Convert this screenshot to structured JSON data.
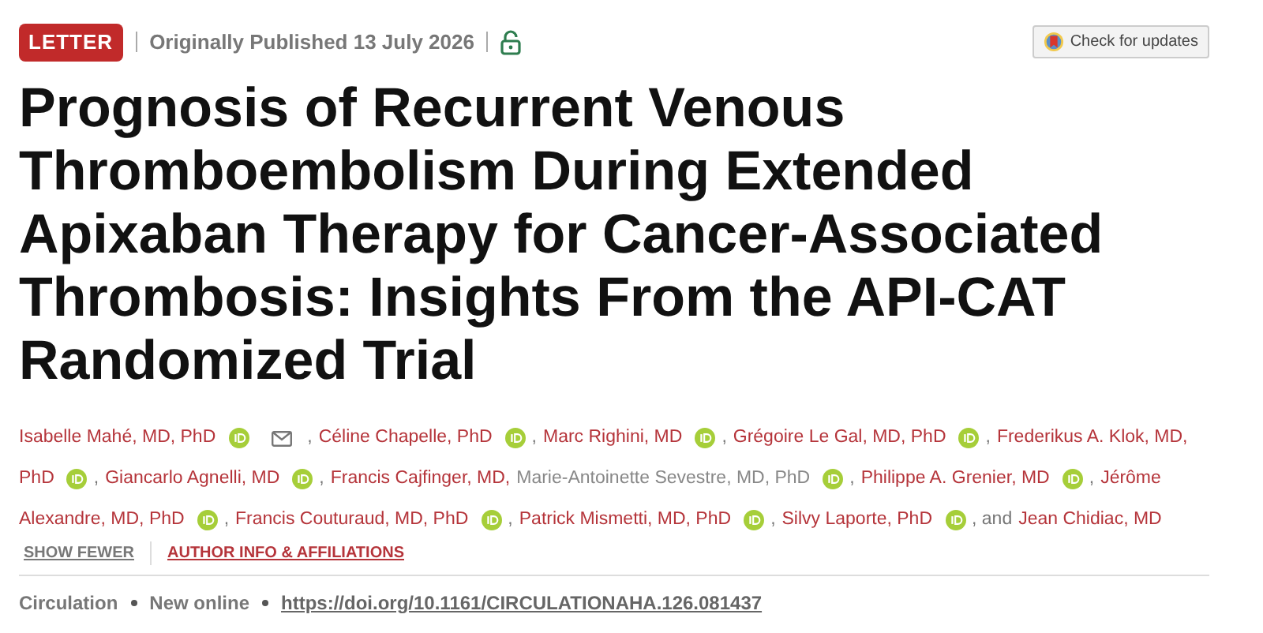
{
  "header": {
    "badge": "LETTER",
    "published": "Originally Published 13 July 2026",
    "open_access": true,
    "updates_button": "Check for updates"
  },
  "title": "Prognosis of Recurrent Venous Thromboembolism During Extended Apixaban Therapy for Cancer-Associated Thrombosis: Insights From the API-CAT Randomized Trial",
  "author_lines": [
    [
      {
        "name": "Isabelle Mahé, MD, PhD",
        "linked": true,
        "orcid": true,
        "email": true
      },
      {
        "prefix": ",",
        "name": "Céline Chapelle, PhD",
        "linked": true,
        "orcid": true
      },
      {
        "prefix": ",",
        "name": "Marc Righini, MD",
        "linked": true,
        "orcid": true
      },
      {
        "prefix": ",",
        "name": "Grégoire Le Gal, MD, PhD",
        "linked": true,
        "orcid": true
      },
      {
        "prefix": ",",
        "name": "Frederikus A. Klok, MD,",
        "linked": true
      }
    ],
    [
      {
        "name": "PhD",
        "linked": true,
        "orcid": true
      },
      {
        "prefix": ",",
        "name": "Giancarlo Agnelli, MD",
        "linked": true,
        "orcid": true
      },
      {
        "prefix": ",",
        "name": "Francis Cajfinger, MD,",
        "linked": true
      },
      {
        "name": "Marie-Antoinette Sevestre, MD, PhD",
        "linked": false,
        "orcid": true
      },
      {
        "prefix": ",",
        "name": "Philippe A. Grenier, MD",
        "linked": true,
        "orcid": true
      },
      {
        "prefix": ",",
        "name": "Jérôme",
        "linked": true
      }
    ],
    [
      {
        "name": "Alexandre, MD, PhD",
        "linked": true,
        "orcid": true
      },
      {
        "prefix": ",",
        "name": "Francis Couturaud, MD, PhD",
        "linked": true,
        "orcid": true
      },
      {
        "prefix": ",",
        "name": "Patrick Mismetti, MD, PhD",
        "linked": true,
        "orcid": true
      },
      {
        "prefix": ",",
        "name": "Silvy Laporte, PhD",
        "linked": true,
        "orcid": true
      },
      {
        "prefix": ", and",
        "name": "Jean Chidiac, MD",
        "linked": true
      }
    ]
  ],
  "author_links": [
    "SHOW FEWER",
    "AUTHOR INFO & AFFILIATIONS"
  ],
  "citation": {
    "journal": "Circulation",
    "status": "New online",
    "doi": "https://doi.org/10.1161/CIRCULATIONAHA.126.081437"
  }
}
